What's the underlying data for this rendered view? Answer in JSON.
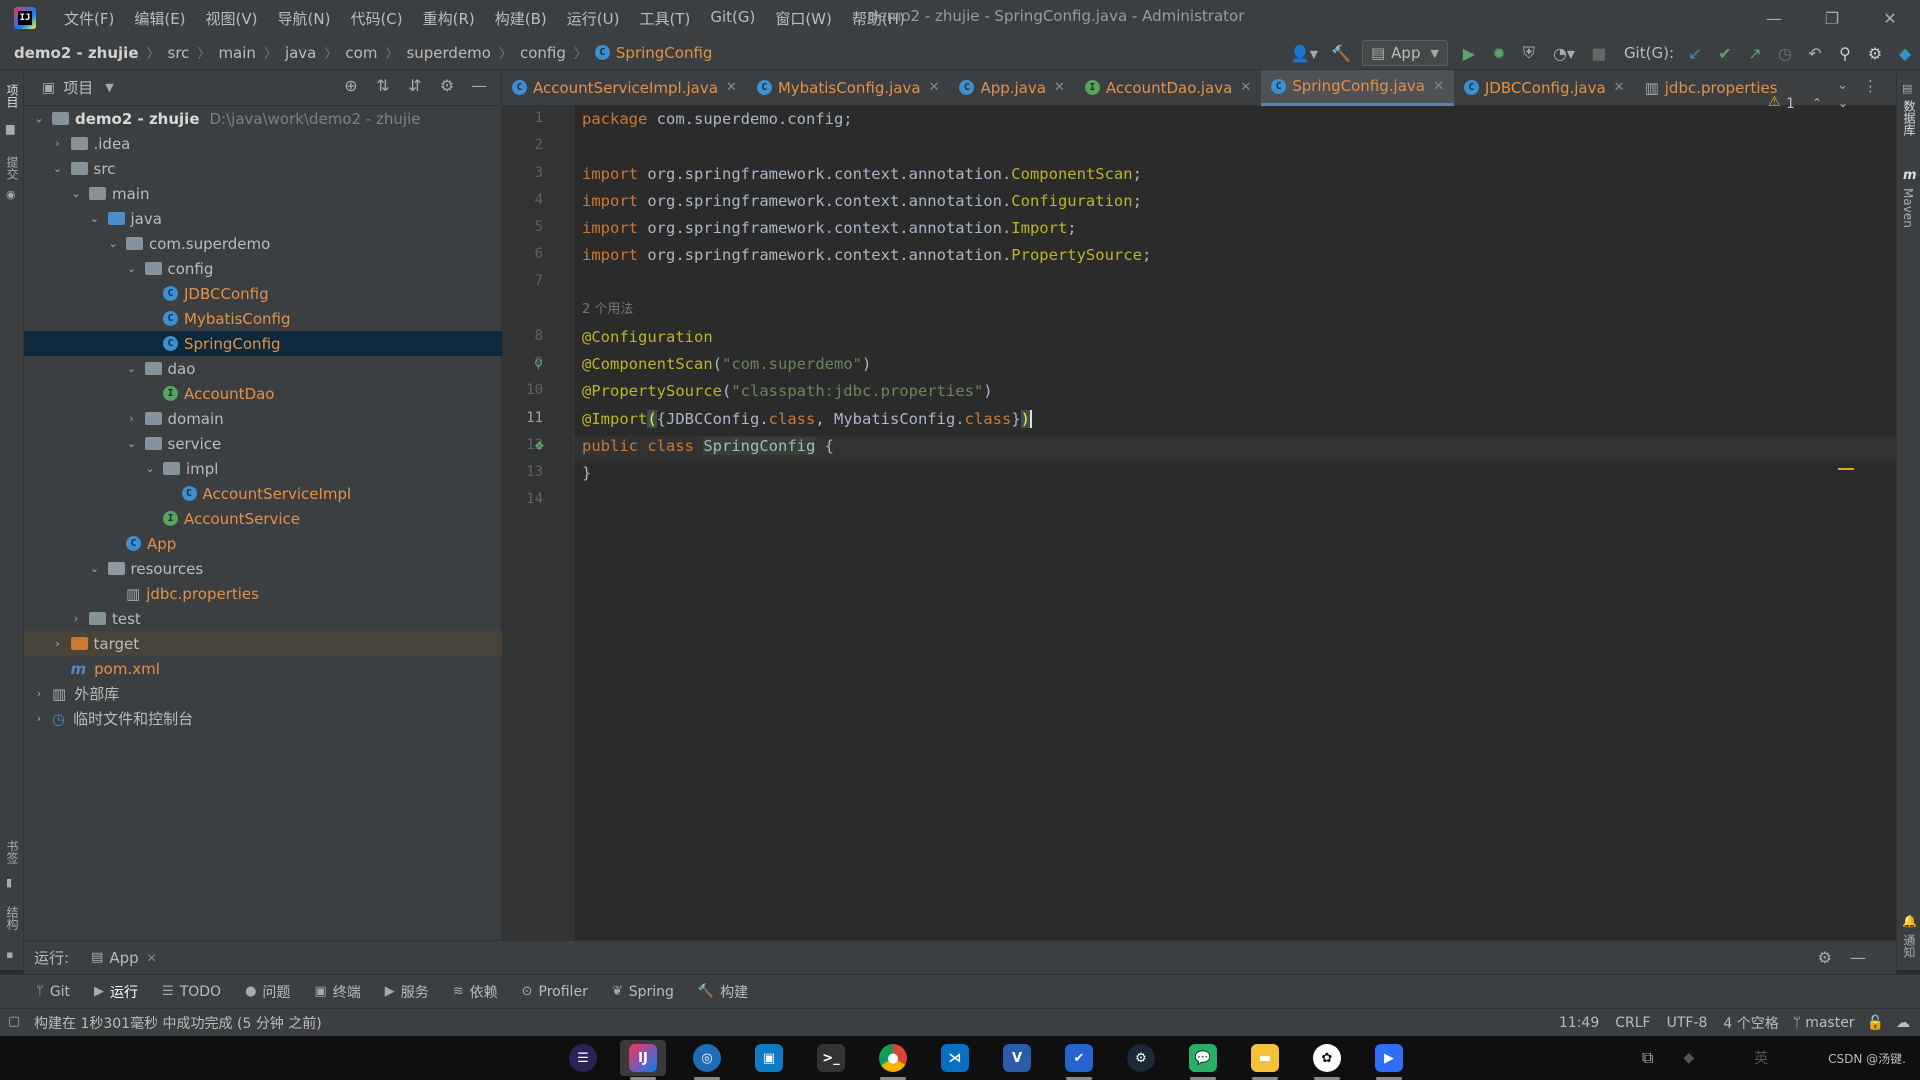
{
  "window": {
    "title": "demo2 - zhujie - SpringConfig.java - Administrator",
    "minimize": "—",
    "restore": "❐",
    "close": "✕"
  },
  "menu": [
    "文件(F)",
    "编辑(E)",
    "视图(V)",
    "导航(N)",
    "代码(C)",
    "重构(R)",
    "构建(B)",
    "运行(U)",
    "工具(T)",
    "Git(G)",
    "窗口(W)",
    "帮助(H)"
  ],
  "breadcrumbs": [
    "demo2 - zhujie",
    "src",
    "main",
    "java",
    "com",
    "superdemo",
    "config",
    "SpringConfig"
  ],
  "toolbar": {
    "run_config": "App",
    "git_label": "Git(G):"
  },
  "left_stripe": {
    "project": "项目",
    "commit": "提交",
    "bookmarks": "书签",
    "structure": "结构"
  },
  "right_stripe": {
    "database": "数据库",
    "maven": "Maven",
    "notifications": "通知"
  },
  "project_panel": {
    "title": "项目",
    "tree": [
      {
        "label": "demo2 - zhujie",
        "hint": "D:\\java\\work\\demo2 - zhujie",
        "indent": 0,
        "arrow": "open",
        "kind": "module"
      },
      {
        "label": ".idea",
        "indent": 1,
        "arrow": "closed",
        "kind": "folder"
      },
      {
        "label": "src",
        "indent": 1,
        "arrow": "open",
        "kind": "folder"
      },
      {
        "label": "main",
        "indent": 2,
        "arrow": "open",
        "kind": "folder"
      },
      {
        "label": "java",
        "indent": 3,
        "arrow": "open",
        "kind": "source"
      },
      {
        "label": "com.superdemo",
        "indent": 4,
        "arrow": "open",
        "kind": "package"
      },
      {
        "label": "config",
        "indent": 5,
        "arrow": "open",
        "kind": "package"
      },
      {
        "label": "JDBCConfig",
        "indent": 6,
        "arrow": "none",
        "kind": "class"
      },
      {
        "label": "MybatisConfig",
        "indent": 6,
        "arrow": "none",
        "kind": "class"
      },
      {
        "label": "SpringConfig",
        "indent": 6,
        "arrow": "none",
        "kind": "class",
        "selected": true
      },
      {
        "label": "dao",
        "indent": 5,
        "arrow": "open",
        "kind": "package"
      },
      {
        "label": "AccountDao",
        "indent": 6,
        "arrow": "none",
        "kind": "interface"
      },
      {
        "label": "domain",
        "indent": 5,
        "arrow": "closed",
        "kind": "package"
      },
      {
        "label": "service",
        "indent": 5,
        "arrow": "open",
        "kind": "package"
      },
      {
        "label": "impl",
        "indent": 6,
        "arrow": "open",
        "kind": "package"
      },
      {
        "label": "AccountServiceImpl",
        "indent": 7,
        "arrow": "none",
        "kind": "class"
      },
      {
        "label": "AccountService",
        "indent": 6,
        "arrow": "none",
        "kind": "interface"
      },
      {
        "label": "App",
        "indent": 4,
        "arrow": "none",
        "kind": "class"
      },
      {
        "label": "resources",
        "indent": 3,
        "arrow": "open",
        "kind": "resources"
      },
      {
        "label": "jdbc.properties",
        "indent": 4,
        "arrow": "none",
        "kind": "properties"
      },
      {
        "label": "test",
        "indent": 2,
        "arrow": "closed",
        "kind": "folder"
      },
      {
        "label": "target",
        "indent": 1,
        "arrow": "closed",
        "kind": "target",
        "highlight": true
      },
      {
        "label": "pom.xml",
        "indent": 1,
        "arrow": "none",
        "kind": "maven"
      },
      {
        "label": "外部库",
        "indent": 0,
        "arrow": "closed",
        "kind": "libs"
      },
      {
        "label": "临时文件和控制台",
        "indent": 0,
        "arrow": "closed",
        "kind": "scratch"
      }
    ]
  },
  "editor_tabs": [
    {
      "label": "AccountServiceImpl.java",
      "icon": "C",
      "active": false
    },
    {
      "label": "MybatisConfig.java",
      "icon": "C",
      "active": false
    },
    {
      "label": "App.java",
      "icon": "C",
      "active": false
    },
    {
      "label": "AccountDao.java",
      "icon": "I",
      "active": false
    },
    {
      "label": "SpringConfig.java",
      "icon": "C",
      "active": true
    },
    {
      "label": "JDBCConfig.java",
      "icon": "C",
      "active": false
    },
    {
      "label": "jdbc.properties",
      "icon": "P",
      "active": false
    }
  ],
  "editor": {
    "warning_count": "1",
    "usage_hint": "2 个用法",
    "line_numbers": [
      "1",
      "2",
      "3",
      "4",
      "5",
      "6",
      "7",
      "8",
      "9",
      "10",
      "11",
      "12",
      "13",
      "14"
    ],
    "current_line": "11"
  },
  "run_bar": {
    "label": "运行:",
    "tab": "App"
  },
  "tool_buttons": [
    "Git",
    "运行",
    "TODO",
    "问题",
    "终端",
    "服务",
    "依赖",
    "Profiler",
    "Spring",
    "构建"
  ],
  "status": {
    "message": "构建在 1秒301毫秒 中成功完成 (5 分钟 之前)",
    "position": "11:49",
    "line_sep": "CRLF",
    "encoding": "UTF-8",
    "indent": "4 个空格",
    "branch": "master"
  },
  "taskbar": {
    "watermark": "CSDN @汤键."
  },
  "colors": {
    "accent": "#4a88c7",
    "orange_text": "#e39146",
    "keyword": "#cc7832",
    "annotation": "#bbb529",
    "string": "#6a8759"
  }
}
